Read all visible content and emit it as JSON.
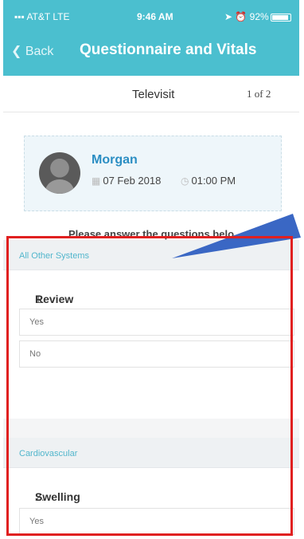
{
  "status_bar": {
    "carrier": "AT&T LTE",
    "time": "9:46 AM",
    "battery": "92%",
    "battery_level": 0.92
  },
  "nav": {
    "back_label": "Back",
    "title": "Questionnaire and Vitals"
  },
  "subheader": {
    "title": "Televisit",
    "page": "1 of 2"
  },
  "patient": {
    "name": "Morgan",
    "date": "07 Feb 2018",
    "time": "01:00 PM"
  },
  "instructions": "Please answer the questions belo",
  "sections": [
    {
      "label": "All Other Systems",
      "question_number": "1.",
      "question": "Review of Systems (ROS)",
      "options": [
        "Yes",
        "No"
      ]
    },
    {
      "label": "Cardiovascular",
      "question_number": "2.",
      "question": "Swelling in hands/feet",
      "options": [
        "Yes"
      ]
    }
  ],
  "colors": {
    "header": "#4bbfcf",
    "accent": "#52b6cc",
    "patient_name": "#2b8ec3",
    "highlight": "#e02020",
    "pointer": "#3a67c4"
  }
}
